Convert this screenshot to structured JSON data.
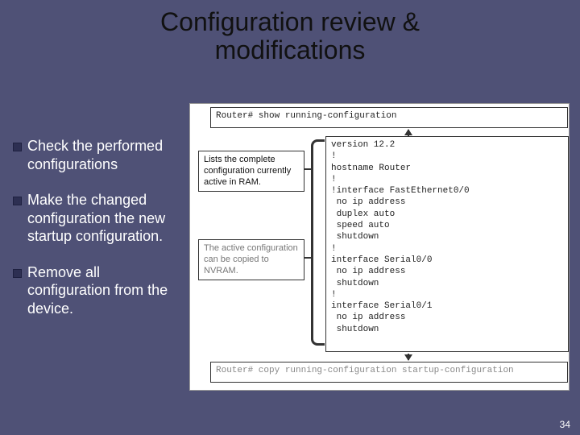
{
  "title_line1": "Configuration review &",
  "title_line2": "modifications",
  "bullets": [
    "Check the performed configurations",
    "Make the changed configuration the new startup configuration.",
    "Remove all configuration from the device."
  ],
  "top_command": "Router# show running-configuration",
  "note_ram": "Lists the complete configuration currently active in RAM.",
  "note_nvram": "The active configuration can be copied to NVRAM.",
  "running_config": "version 12.2\n!\nhostname Router\n!\n!interface FastEthernet0/0\n no ip address\n duplex auto\n speed auto\n shutdown\n!\ninterface Serial0/0\n no ip address\n shutdown\n!\ninterface Serial0/1\n no ip address\n shutdown",
  "bottom_command": "Router# copy running-configuration startup-configuration",
  "page_number": "34"
}
